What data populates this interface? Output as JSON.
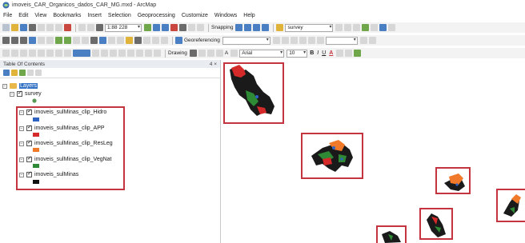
{
  "window": {
    "title": "imoveis_CAR_Organicos_dados_CAR_MG.mxd - ArcMap"
  },
  "menu": [
    "File",
    "Edit",
    "View",
    "Bookmarks",
    "Insert",
    "Selection",
    "Geoprocessing",
    "Customize",
    "Windows",
    "Help"
  ],
  "toolbar": {
    "scale": "1:88 228",
    "snapping_label": "Snapping",
    "georeferencing_label": "Georeferencing",
    "layer_combo": "survey",
    "drawing_label": "Drawing",
    "font_name": "Arial",
    "font_size": "10",
    "bold": "B",
    "italic": "I",
    "underline": "U",
    "font_color_letter": "A"
  },
  "toc": {
    "title": "Table Of Contents",
    "pin": "4 ×",
    "root_layer": "Layers",
    "layers": [
      {
        "name": "survey",
        "symbol_color": "#5a9a56",
        "symbol": "point"
      },
      {
        "name": "imoveis_sulMinas_clip_Hidro",
        "symbol_color": "#2e63c4",
        "symbol": "fill"
      },
      {
        "name": "imoveis_sulMinas_clip_APP",
        "symbol_color": "#d42a2a",
        "symbol": "fill"
      },
      {
        "name": "imoveis_sulMinas_clip_ResLeg",
        "symbol_color": "#f07a2a",
        "symbol": "fill"
      },
      {
        "name": "imoveis_sulMinas_clip_VegNat",
        "symbol_color": "#2e8a35",
        "symbol": "fill"
      },
      {
        "name": "imoveis_sulMinas",
        "symbol_color": "#111111",
        "symbol": "fill"
      }
    ]
  },
  "colors": {
    "highlight": "#c4343e",
    "parcel": "#1a1a1a",
    "app": "#d42a2a",
    "resleg": "#f07a2a",
    "vegnat": "#2e8a35",
    "hidro": "#2e63c4"
  }
}
